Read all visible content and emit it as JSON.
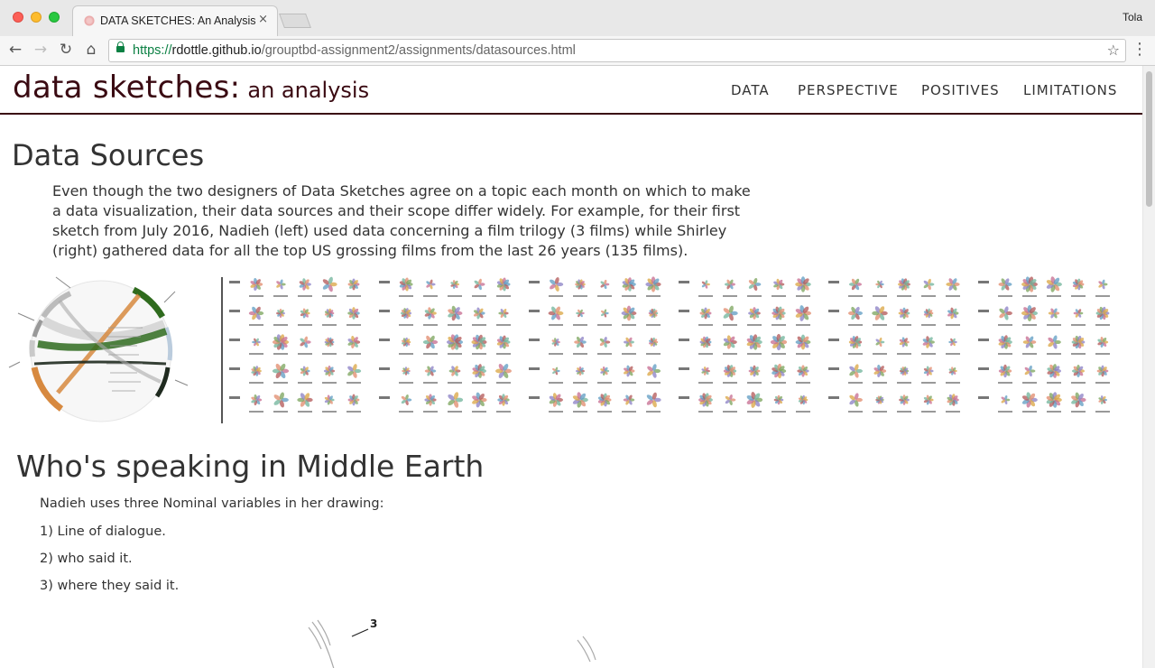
{
  "browser": {
    "tab_title": "DATA SKETCHES: An Analysis",
    "tab_close": "×",
    "profile_name": "Tola",
    "url_scheme": "https://",
    "url_host": "rdottle.github.io",
    "url_path": "/grouptbd-assignment2/assignments/datasources.html",
    "back_glyph": "←",
    "forward_glyph": "→",
    "reload_glyph": "↻",
    "home_glyph": "⌂",
    "star_glyph": "☆",
    "menu_glyph": "⋮"
  },
  "site": {
    "brand_main": "data sketches:",
    "brand_sub": "an analysis",
    "nav": [
      "DATA",
      "PERSPECTIVE",
      "POSITIVES",
      "LIMITATIONS"
    ]
  },
  "data_sources": {
    "title": "Data Sources",
    "intro": "Even though the two designers of Data Sketches agree on a topic each month on which to make a data visualization, their data sources and their scope differ widely. For example, for their first sketch from July 2016, Nadieh (left) used data concerning a film trilogy (3 films) while Shirley (right) gathered data for all the top US grossing films from the last 26 years (135 films)."
  },
  "who_speaking": {
    "title": "Who's speaking in Middle Earth",
    "lead": "Nadieh uses three Nominal variables in her drawing:",
    "items": [
      "1) Line of dialogue.",
      "2) who said it.",
      "3) where they said it."
    ]
  },
  "sketch_labels": {
    "annotation_number": "3"
  },
  "colors": {
    "brand": "#3a0a12",
    "text": "#333333",
    "url_green": "#0b8043",
    "chord_green": "#2f6b1e",
    "chord_orange": "#d7893f",
    "chord_dark": "#1f2a1f"
  },
  "icons": [
    "lock-icon",
    "star-icon",
    "back-icon",
    "forward-icon",
    "reload-icon",
    "home-icon",
    "menu-icon",
    "close-icon"
  ]
}
